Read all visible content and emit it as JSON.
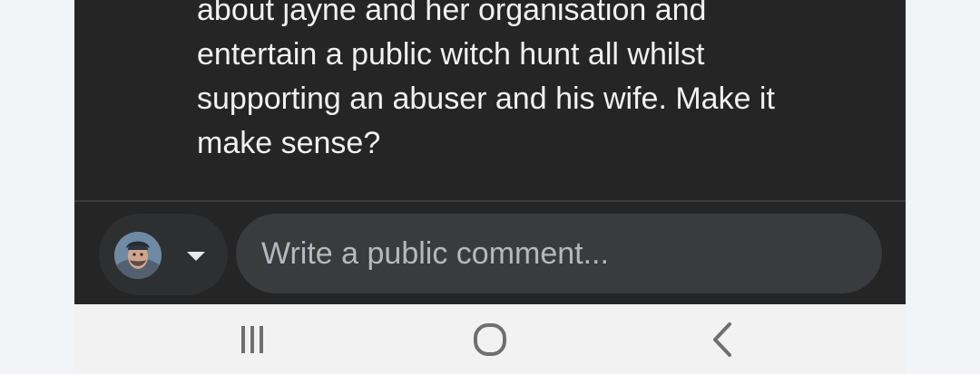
{
  "post": {
    "lines": [
      "about jayne and her organisation and",
      "entertain a public witch hunt all whilst",
      "supporting an abuser and his wife. Make it",
      "make sense?"
    ]
  },
  "comment_bar": {
    "placeholder": "Write a public comment..."
  },
  "system_nav": {
    "recents_icon": "recents-icon",
    "home_icon": "home-icon",
    "back_icon": "back-icon"
  },
  "colors": {
    "background": "#f3f4f7",
    "dark_panel": "#252526",
    "text": "#f1f1f1",
    "comment_box": "#3a3b3d",
    "placeholder": "#b7b8bb",
    "nav_icons": "#6f6f6f"
  }
}
